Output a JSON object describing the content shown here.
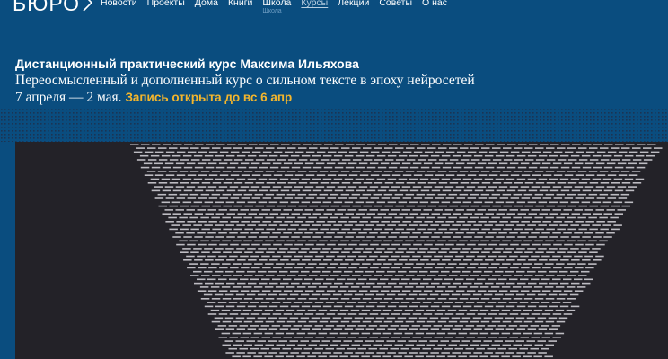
{
  "header": {
    "logo_text": "БЮРО",
    "logo_mark_icon": "chevron-right-icon",
    "nav": [
      {
        "label": "Новости"
      },
      {
        "label": "Проекты"
      },
      {
        "label": "Дома"
      },
      {
        "label": "Книги"
      },
      {
        "label": "Школа",
        "sub": "Школа"
      },
      {
        "label": "Курсы",
        "active": true
      },
      {
        "label": "Лекции"
      },
      {
        "label": "Советы"
      },
      {
        "label": "О нас"
      }
    ]
  },
  "hero": {
    "title": "Дистанционный практический курс Максима Ильяхова",
    "subtitle": "Переосмысленный и дополненный курс о сильном тексте в эпоху нейросетей",
    "dates": "7 апреля — 2 мая.",
    "cta": "Запись открыта до вс 6 апр"
  },
  "colors": {
    "background": "#0a4d7f",
    "accent": "#f5b62c",
    "nav_active": "#b9cfe1",
    "art_background": "#232228",
    "art_stripe": "#bdbcc2",
    "art_dot": "#1f2b45"
  }
}
